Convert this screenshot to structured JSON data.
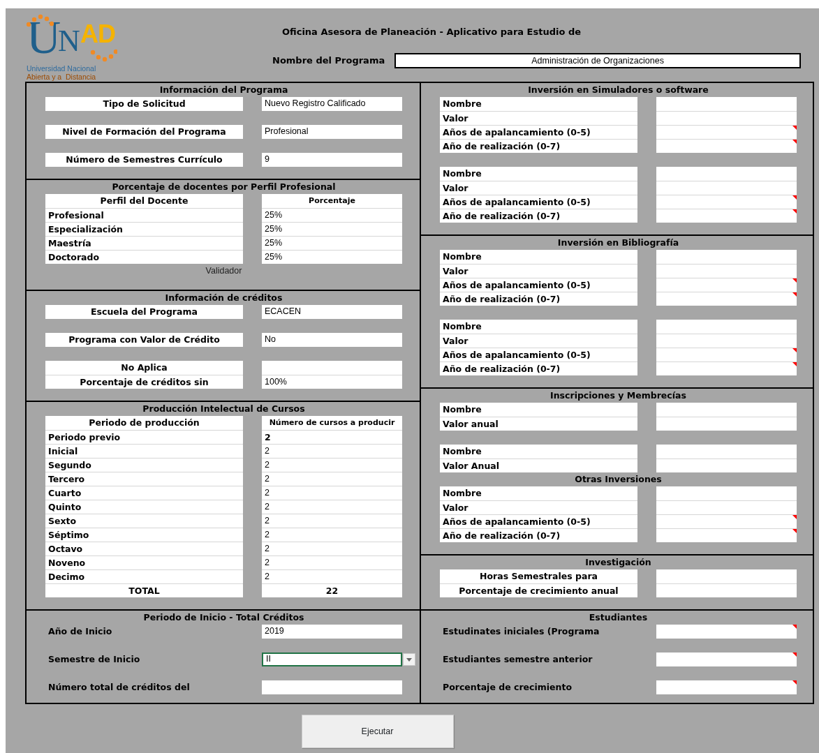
{
  "logo": {
    "mark_left": "U",
    "mark_mid": "N",
    "mark_right": "AD",
    "line1": "Universidad Nacional",
    "line2": "Abierta y a  Distancia"
  },
  "title": "Oficina Asesora de Planeación - Aplicativo para Estudio de",
  "program": {
    "label": "Nombre del Programa",
    "value": "Administración de Organizaciones"
  },
  "columns": [
    {
      "sections": [
        {
          "title": "Información del Programa",
          "kind": "centered",
          "groups": [
            {
              "rows": [
                {
                  "kind": "field",
                  "label": "Tipo de Solicitud",
                  "value": "Nuevo Registro Calificado"
                }
              ]
            },
            {
              "rows": [
                {
                  "kind": "field",
                  "label": "Nivel de Formación del Programa",
                  "value": "Profesional"
                }
              ]
            },
            {
              "rows": [
                {
                  "kind": "field",
                  "label": "Número de Semestres Currículo",
                  "value": "9"
                }
              ]
            }
          ]
        },
        {
          "title": "Porcentaje de docentes por Perfil Profesional",
          "kind": "table",
          "note": "Validador",
          "groups": [
            {
              "rows": [
                {
                  "kind": "header",
                  "label": "Perfil del Docente",
                  "value": "Porcentaje"
                },
                {
                  "kind": "field",
                  "label": "Profesional",
                  "value": "25%"
                },
                {
                  "kind": "field",
                  "label": "Especialización",
                  "value": "25%"
                },
                {
                  "kind": "field",
                  "label": "Maestría",
                  "value": "25%"
                },
                {
                  "kind": "field",
                  "label": "Doctorado",
                  "value": "25%"
                }
              ]
            }
          ]
        },
        {
          "title": "Información de créditos",
          "kind": "centered",
          "groups": [
            {
              "rows": [
                {
                  "kind": "field",
                  "label": "Escuela del Programa",
                  "value": "ECACEN"
                }
              ]
            },
            {
              "rows": [
                {
                  "kind": "field",
                  "label": "Programa con Valor de Crédito",
                  "value": "No"
                }
              ]
            },
            {
              "rows": [
                {
                  "kind": "field",
                  "label": "No Aplica"
                },
                {
                  "kind": "field",
                  "label": "Porcentaje de créditos sin",
                  "value": "100%"
                }
              ]
            }
          ]
        },
        {
          "title": "Producción Intelectual de Cursos",
          "kind": "table",
          "groups": [
            {
              "rows": [
                {
                  "kind": "header",
                  "label": "Periodo de producción",
                  "value": "Número de cursos a producir"
                },
                {
                  "kind": "field",
                  "label": "Periodo previo",
                  "value": "2",
                  "bold": true
                },
                {
                  "kind": "field",
                  "label": "Inicial",
                  "value": "2",
                  "bold": false
                },
                {
                  "kind": "field",
                  "label": "Segundo",
                  "value": "2",
                  "bold": false
                },
                {
                  "kind": "field",
                  "label": "Tercero",
                  "value": "2",
                  "bold": false
                },
                {
                  "kind": "field",
                  "label": "Cuarto",
                  "value": "2",
                  "bold": false
                },
                {
                  "kind": "field",
                  "label": "Quinto",
                  "value": "2",
                  "bold": false
                },
                {
                  "kind": "field",
                  "label": "Sexto",
                  "value": "2",
                  "bold": false
                },
                {
                  "kind": "field",
                  "label": "Séptimo",
                  "value": "2",
                  "bold": false
                },
                {
                  "kind": "field",
                  "label": "Octavo",
                  "value": "2",
                  "bold": false
                },
                {
                  "kind": "field",
                  "label": "Noveno",
                  "value": "2",
                  "bold": false
                },
                {
                  "kind": "field",
                  "label": "Decimo",
                  "value": "2",
                  "bold": false
                },
                {
                  "kind": "total",
                  "label": "TOTAL",
                  "value": "22"
                }
              ]
            }
          ]
        }
      ]
    },
    {
      "sections": [
        {
          "title": "Inversión en Simuladores o software",
          "kind": "left",
          "groups": [
            {
              "rows": [
                {
                  "kind": "field",
                  "label": "Nombre",
                  "comment": false
                },
                {
                  "kind": "field",
                  "label": "Valor",
                  "comment": false
                },
                {
                  "kind": "field",
                  "label": "Años de apalancamiento (0-5)",
                  "comment": true
                },
                {
                  "kind": "field",
                  "label": "Año de realización (0-7)",
                  "comment": true
                }
              ]
            },
            {
              "rows": [
                {
                  "kind": "field",
                  "label": "Nombre",
                  "comment": false
                },
                {
                  "kind": "field",
                  "label": "Valor",
                  "comment": false
                },
                {
                  "kind": "field",
                  "label": "Años de apalancamiento (0-5)",
                  "comment": true
                },
                {
                  "kind": "field",
                  "label": "Año de realización (0-7)",
                  "comment": true
                }
              ]
            }
          ]
        },
        {
          "title": "Inversión en Bibliografía",
          "kind": "left",
          "groups": [
            {
              "rows": [
                {
                  "kind": "field",
                  "label": "Nombre",
                  "comment": false
                },
                {
                  "kind": "field",
                  "label": "Valor",
                  "comment": false
                },
                {
                  "kind": "field",
                  "label": "Años de apalancamiento (0-5)",
                  "comment": true
                },
                {
                  "kind": "field",
                  "label": "Año de realización (0-7)",
                  "comment": true
                }
              ]
            },
            {
              "rows": [
                {
                  "kind": "field",
                  "label": "Nombre",
                  "comment": false
                },
                {
                  "kind": "field",
                  "label": "Valor",
                  "comment": false
                },
                {
                  "kind": "field",
                  "label": "Años de apalancamiento (0-5)",
                  "comment": true
                },
                {
                  "kind": "field",
                  "label": "Año de realización (0-7)",
                  "comment": true
                }
              ]
            }
          ]
        },
        {
          "title": "Inscripciones y Membrecías",
          "kind": "left",
          "groups": [
            {
              "rows": [
                {
                  "kind": "field",
                  "label": "Nombre"
                },
                {
                  "kind": "field",
                  "label": "Valor anual"
                }
              ]
            },
            {
              "rows": [
                {
                  "kind": "field",
                  "label": "Nombre"
                },
                {
                  "kind": "field",
                  "label": "Valor Anual"
                }
              ]
            },
            {
              "title": "Otras Inversiones",
              "rows": [
                {
                  "kind": "field",
                  "label": "Nombre",
                  "comment": false
                },
                {
                  "kind": "field",
                  "label": "Valor",
                  "comment": false
                },
                {
                  "kind": "field",
                  "label": "Años de apalancamiento (0-5)",
                  "comment": true
                },
                {
                  "kind": "field",
                  "label": "Año de realización (0-7)",
                  "comment": true
                }
              ]
            }
          ]
        },
        {
          "title": "Investigación",
          "kind": "centered",
          "groups": [
            {
              "rows": [
                {
                  "kind": "field",
                  "label": "Horas Semestrales para"
                },
                {
                  "kind": "field",
                  "label": "Porcentaje de crecimiento anual"
                }
              ]
            }
          ]
        }
      ]
    }
  ],
  "bottom": [
    {
      "title": "Periodo de Inicio - Total Créditos",
      "kind": "plain",
      "groups": [
        {
          "rows": [
            {
              "kind": "field",
              "label": "Año de Inicio",
              "value": "2019"
            }
          ]
        },
        {
          "rows": [
            {
              "kind": "dropdown",
              "label": "Semestre de Inicio",
              "value": "II"
            }
          ]
        },
        {
          "rows": [
            {
              "kind": "field",
              "label": "Número total de créditos del"
            }
          ]
        }
      ]
    },
    {
      "title": "Estudiantes",
      "kind": "plain",
      "groups": [
        {
          "rows": [
            {
              "kind": "field",
              "label": "Estudinates iniciales (Programa",
              "comment": true
            }
          ]
        },
        {
          "rows": [
            {
              "kind": "field",
              "label": "Estudiantes semestre anterior",
              "comment": true
            }
          ]
        },
        {
          "rows": [
            {
              "kind": "field",
              "label": "Porcentaje de crecimiento",
              "comment": true
            }
          ]
        }
      ]
    }
  ],
  "button": "Ejecutar"
}
